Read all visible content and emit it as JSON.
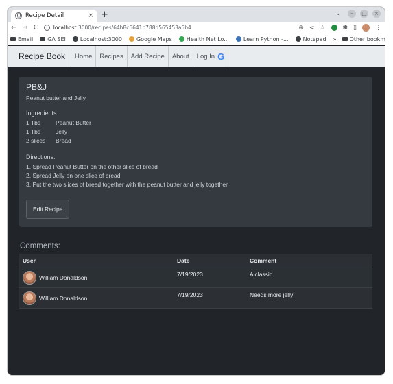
{
  "browser": {
    "tab_title": "Recipe Detail",
    "tab_close": "×",
    "new_tab": "+",
    "url_host": "localhost",
    "url_path": ":3000/recipes/64b8c6641b788d565453a5b4",
    "bookmarks": [
      "Email",
      "GA SEI",
      "Localhost:3000",
      "Google Maps",
      "Health Net Lo...",
      "Learn Python -...",
      "Notepad"
    ],
    "bookmarks_overflow": "»",
    "other_bookmarks": "Other bookmarks"
  },
  "navbar": {
    "brand": "Recipe Book",
    "links": [
      "Home",
      "Recipes",
      "Add Recipe",
      "About",
      "Log In"
    ],
    "google_glyph": "G"
  },
  "recipe": {
    "name": "PB&J",
    "description": "Peanut butter and Jelly",
    "ingredients_label": "Ingredients:",
    "ingredients": [
      {
        "qty": "1 Tbs",
        "item": "Peanut Butter"
      },
      {
        "qty": "1 Tbs",
        "item": "Jelly"
      },
      {
        "qty": "2 slices",
        "item": "Bread"
      }
    ],
    "directions_label": "Directions:",
    "directions": [
      "1. Spread Peanut Butter on the other slice of bread",
      "2. Spread Jelly on one slice of bread",
      "3. Put the two slices of bread together with the peanut butter and jelly together"
    ],
    "edit_button": "Edit Recipe"
  },
  "comments": {
    "title": "Comments:",
    "headers": [
      "User",
      "Date",
      "Comment"
    ],
    "rows": [
      {
        "user": "William Donaldson",
        "date": "7/19/2023",
        "comment": "A classic"
      },
      {
        "user": "William Donaldson",
        "date": "7/19/2023",
        "comment": "Needs more jelly!"
      }
    ]
  }
}
